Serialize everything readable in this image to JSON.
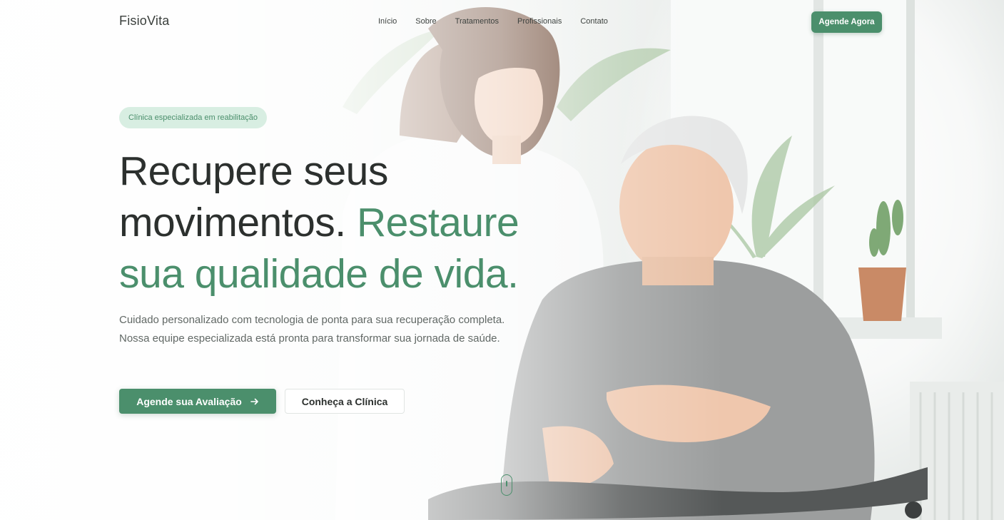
{
  "header": {
    "logo": "FisioVita",
    "nav": [
      {
        "label": "Início"
      },
      {
        "label": "Sobre"
      },
      {
        "label": "Tratamentos"
      },
      {
        "label": "Profissionais"
      },
      {
        "label": "Contato"
      }
    ],
    "cta_label": "Agende Agora"
  },
  "hero": {
    "badge": "Clínica especializada em reabilitação",
    "headline_part1": "Recupere seus movimentos.",
    "headline_part2": "Restaure sua qualidade de vida.",
    "lead": "Cuidado personalizado com tecnologia de ponta para sua recuperação completa. Nossa equipe especializada está pronta para transformar sua jornada de saúde.",
    "primary_button": "Agende sua Avaliação",
    "secondary_button": "Conheça a Clínica"
  },
  "icons": {
    "primary_button_icon": "arrow-right-icon",
    "scroll": "mouse-scroll-icon"
  },
  "colors": {
    "accent": "#4b8f6c",
    "badge_bg": "#d1ebdd",
    "text_dark": "#2c302e",
    "text_muted": "#616865"
  }
}
